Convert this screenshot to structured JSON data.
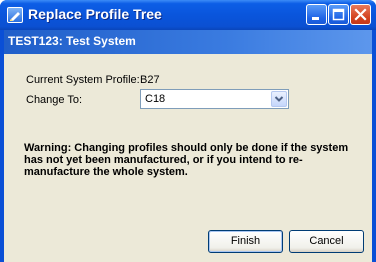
{
  "window": {
    "title": "Replace Profile Tree",
    "icon": "profile-tree-icon",
    "controls": [
      "minimize-icon",
      "maximize-icon",
      "close-icon"
    ]
  },
  "header": {
    "text": "TEST123: Test System"
  },
  "form": {
    "current_label": "Current System Profile:",
    "current_value": "B27",
    "change_label": "Change To:",
    "change_value": "C18"
  },
  "warning": "Warning: Changing profiles should only be done if the system has not yet been manufactured, or if you intend to re-manufacture the whole system.",
  "buttons": {
    "finish": "Finish",
    "cancel": "Cancel"
  },
  "colors": {
    "titlebar": "#0a55dc",
    "header_band": "#2c6dd6",
    "dialog_bg": "#ece9d8",
    "close_button": "#d2401c"
  }
}
